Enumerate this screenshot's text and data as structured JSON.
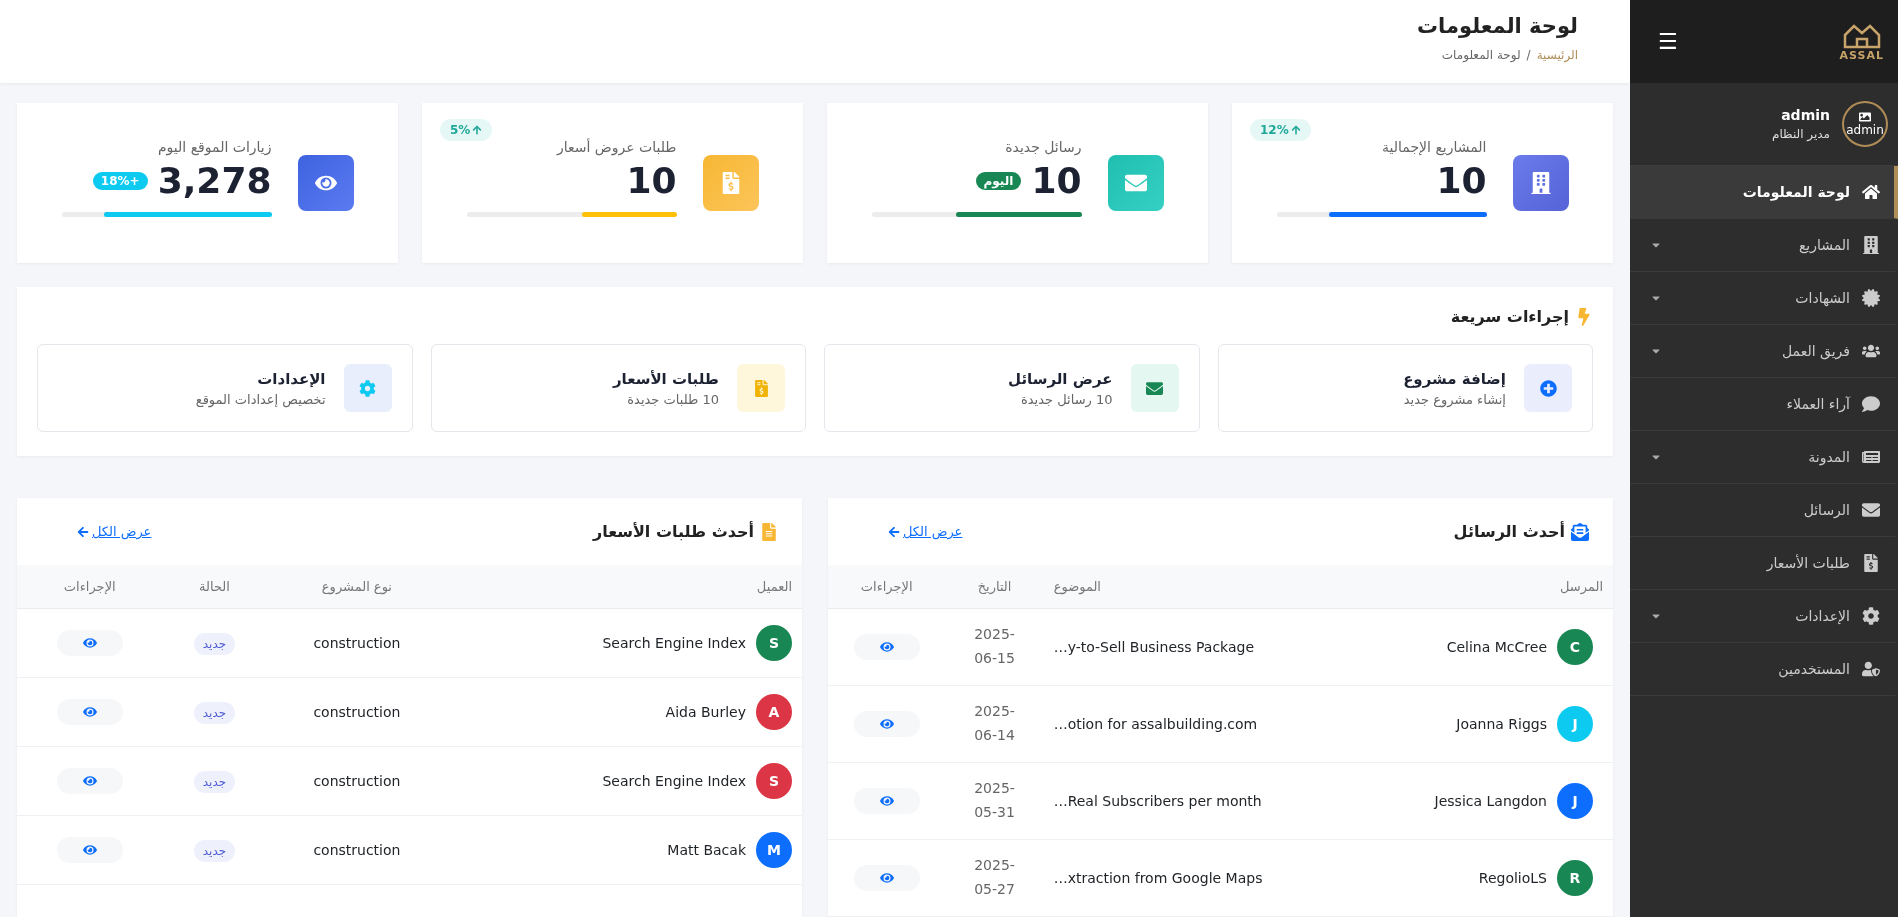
{
  "sidebar": {
    "brand": "ASSAL",
    "menu_glyph": "☰",
    "user": {
      "name": "admin",
      "role": "مدير النظام",
      "avatar_alt": "admin"
    },
    "items": [
      {
        "label": "لوحة المعلومات",
        "selected": true,
        "has_submenu": false
      },
      {
        "label": "المشاريع",
        "selected": false,
        "has_submenu": true
      },
      {
        "label": "الشهادات",
        "selected": false,
        "has_submenu": true
      },
      {
        "label": "فريق العمل",
        "selected": false,
        "has_submenu": true
      },
      {
        "label": "آراء العملاء",
        "selected": false,
        "has_submenu": false
      },
      {
        "label": "المدونة",
        "selected": false,
        "has_submenu": true
      },
      {
        "label": "الرسائل",
        "selected": false,
        "has_submenu": false
      },
      {
        "label": "طلبات الأسعار",
        "selected": false,
        "has_submenu": false
      },
      {
        "label": "الإعدادات",
        "selected": false,
        "has_submenu": true
      },
      {
        "label": "المستخدمين",
        "selected": false,
        "has_submenu": false
      }
    ]
  },
  "header": {
    "title": "لوحة المعلومات",
    "breadcrumb": [
      {
        "label": "الرئيسية",
        "link": true
      },
      {
        "label": "لوحة المعلومات",
        "link": false
      }
    ],
    "separator": "/"
  },
  "stats": [
    {
      "kind": "projects",
      "label": "المشاريع الإجمالية",
      "value": "10",
      "trend": "12%",
      "color": "#0d6efd",
      "level": 0.75
    },
    {
      "kind": "messages",
      "label": "رسائل جديدة",
      "value": "10",
      "badge": "اليوم",
      "color": "#198754",
      "level": 0.6
    },
    {
      "kind": "quotes",
      "label": "طلبات عروض أسعار",
      "value": "10",
      "trend": "5%",
      "color": "#ffc107",
      "level": 0.45
    },
    {
      "kind": "visits",
      "label": "زيارات الموقع اليوم",
      "value": "3,278",
      "badge": "18%+",
      "color": "#0dcaf0",
      "level": 0.8
    }
  ],
  "quick_actions": {
    "title": "إجراءات سريعة",
    "items": [
      {
        "title": "إضافة مشروع",
        "subtitle": "إنشاء مشروع جديد"
      },
      {
        "title": "عرض الرسائل",
        "subtitle": "10 رسائل جديدة"
      },
      {
        "title": "طلبات الأسعار",
        "subtitle": "10 طلبات جديدة"
      },
      {
        "title": "الإعدادات",
        "subtitle": "تخصيص إعدادات الموقع"
      }
    ]
  },
  "messages_table": {
    "title": "أحدث الرسائل",
    "view_all": "عرض الكل",
    "columns": [
      "المرسل",
      "الموضوع",
      "التاريخ",
      "الإجراءات"
    ],
    "rows": [
      {
        "initial": "C",
        "color": "#198754",
        "sender": "Celina McCree",
        "subject": "…y-to-Sell Business Package",
        "date": "2025-06-15"
      },
      {
        "initial": "J",
        "color": "#0dcaf0",
        "sender": "Joanna Riggs",
        "subject": "…otion for assalbuilding.com",
        "date": "2025-06-14"
      },
      {
        "initial": "J",
        "color": "#0d6efd",
        "sender": "Jessica Langdon",
        "subject": "…Real Subscribers per month",
        "date": "2025-05-31"
      },
      {
        "initial": "R",
        "color": "#198754",
        "sender": "RegolioLS",
        "subject": "…xtraction from Google Maps",
        "date": "2025-05-27"
      }
    ]
  },
  "quotes_table": {
    "title": "أحدث طلبات الأسعار",
    "view_all": "عرض الكل",
    "columns": [
      "العميل",
      "نوع المشروع",
      "الحالة",
      "الإجراءات"
    ],
    "rows": [
      {
        "initial": "S",
        "color": "#198754",
        "client": "Search Engine Index",
        "project_type": "construction",
        "status": "جديد"
      },
      {
        "initial": "A",
        "color": "#dc3545",
        "client": "Aida Burley",
        "project_type": "construction",
        "status": "جديد"
      },
      {
        "initial": "S",
        "color": "#dc3545",
        "client": "Search Engine Index",
        "project_type": "construction",
        "status": "جديد"
      },
      {
        "initial": "M",
        "color": "#0d6efd",
        "client": "Matt Bacak",
        "project_type": "construction",
        "status": "جديد"
      }
    ]
  }
}
